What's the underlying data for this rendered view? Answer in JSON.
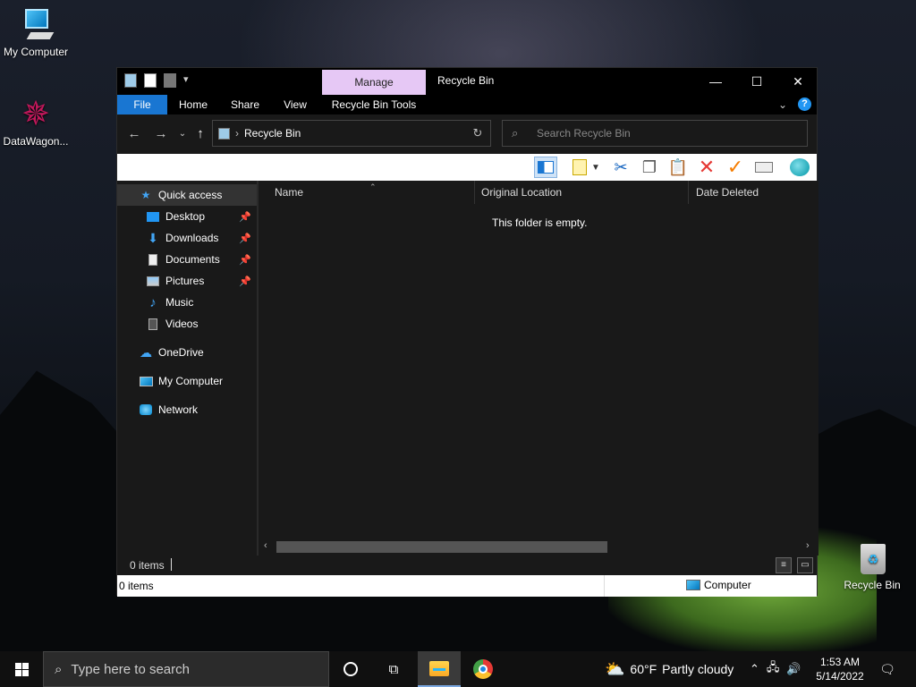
{
  "desktop": {
    "icons": [
      {
        "label": "My Computer"
      },
      {
        "label": "DataWagon..."
      },
      {
        "label": "Recycle Bin"
      }
    ]
  },
  "window": {
    "title": "Recycle Bin",
    "context_tab": "Manage",
    "controls": {
      "minimize": "—",
      "maximize": "☐",
      "close": "✕"
    },
    "ribbon_tabs": [
      {
        "label": "File"
      },
      {
        "label": "Home"
      },
      {
        "label": "Share"
      },
      {
        "label": "View"
      },
      {
        "label": "Recycle Bin Tools"
      }
    ],
    "address": {
      "path": "Recycle Bin"
    },
    "search": {
      "placeholder": "Search Recycle Bin"
    },
    "nav_pane": [
      {
        "label": "Quick access",
        "icon": "star-icon"
      },
      {
        "label": "Desktop",
        "icon": "desktop-folder-icon",
        "pinned": true
      },
      {
        "label": "Downloads",
        "icon": "download-arrow-icon",
        "pinned": true
      },
      {
        "label": "Documents",
        "icon": "document-icon",
        "pinned": true
      },
      {
        "label": "Pictures",
        "icon": "picture-icon",
        "pinned": true
      },
      {
        "label": "Music",
        "icon": "music-note-icon"
      },
      {
        "label": "Videos",
        "icon": "film-icon"
      },
      {
        "label": "OneDrive",
        "icon": "cloud-icon"
      },
      {
        "label": "My Computer",
        "icon": "computer-icon"
      },
      {
        "label": "Network",
        "icon": "network-icon"
      }
    ],
    "columns": [
      "Name",
      "Original Location",
      "Date Deleted"
    ],
    "empty_message": "This folder is empty.",
    "status": {
      "items": "0 items"
    },
    "bottom_status": {
      "left": "0 items",
      "right": "Computer"
    }
  },
  "taskbar": {
    "search_placeholder": "Type here to search",
    "weather": {
      "temp": "60°F",
      "condition": "Partly cloudy"
    },
    "clock": {
      "time": "1:53 AM",
      "date": "5/14/2022"
    }
  },
  "colors": {
    "accent": "#1976d2",
    "manage_tab": "#e6c8f5"
  }
}
